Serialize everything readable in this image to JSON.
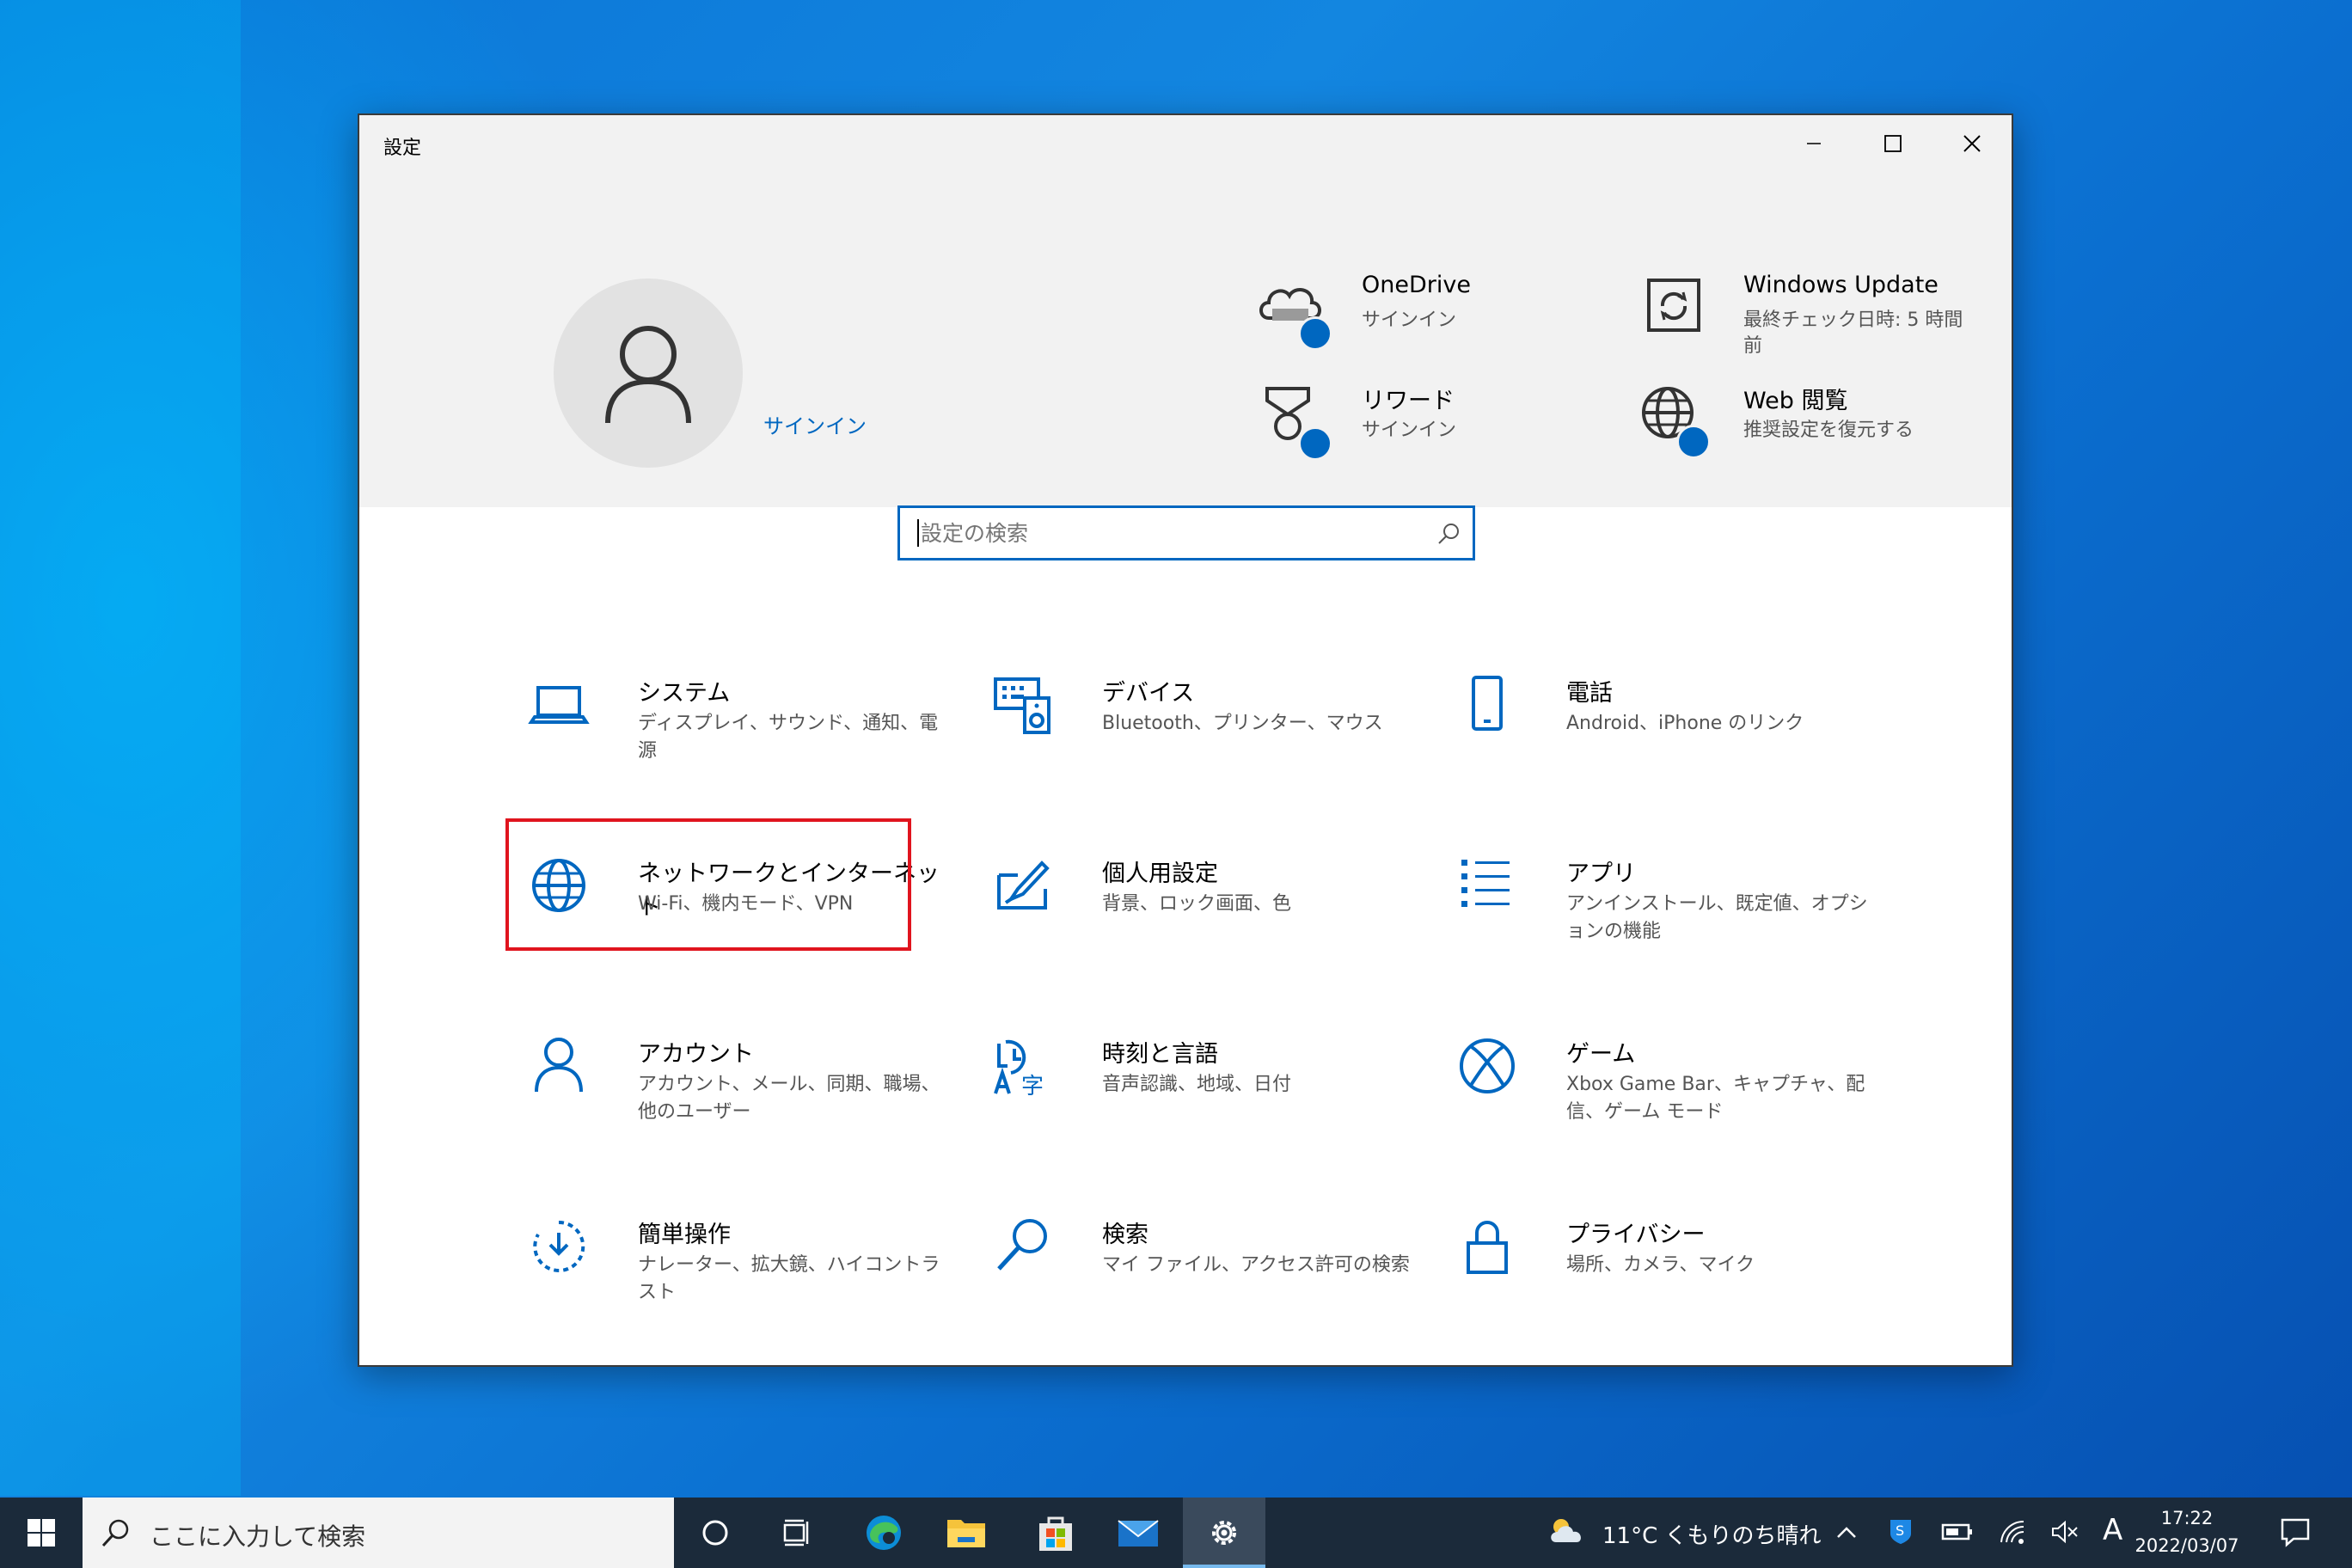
{
  "window": {
    "title": "設定",
    "minimize_glyph": "─",
    "maximize_glyph": "☐",
    "close_glyph": "✕"
  },
  "header": {
    "signin_label": "サインイン",
    "items": [
      {
        "title": "OneDrive",
        "subtitle": "サインイン",
        "icon": "cloud-icon"
      },
      {
        "title": "Windows Update",
        "subtitle": "最終チェック日時: 5 時間前",
        "icon": "update-icon"
      },
      {
        "title": "リワード",
        "subtitle": "サインイン",
        "icon": "rewards-icon"
      },
      {
        "title": "Web 閲覧",
        "subtitle": "推奨設定を復元する",
        "icon": "globe-icon"
      }
    ]
  },
  "search": {
    "placeholder": "設定の検索"
  },
  "categories": [
    {
      "title": "システム",
      "subtitle": "ディスプレイ、サウンド、通知、電源",
      "icon": "laptop-icon"
    },
    {
      "title": "デバイス",
      "subtitle": "Bluetooth、プリンター、マウス",
      "icon": "devices-icon"
    },
    {
      "title": "電話",
      "subtitle": "Android、iPhone のリンク",
      "icon": "phone-icon"
    },
    {
      "title": "ネットワークとインターネット",
      "subtitle": "Wi-Fi、機内モード、VPN",
      "icon": "globe-icon"
    },
    {
      "title": "個人用設定",
      "subtitle": "背景、ロック画面、色",
      "icon": "personalization-icon"
    },
    {
      "title": "アプリ",
      "subtitle": "アンインストール、既定値、オプションの機能",
      "icon": "apps-icon"
    },
    {
      "title": "アカウント",
      "subtitle": "アカウント、メール、同期、職場、他のユーザー",
      "icon": "person-icon"
    },
    {
      "title": "時刻と言語",
      "subtitle": "音声認識、地域、日付",
      "icon": "time-language-icon"
    },
    {
      "title": "ゲーム",
      "subtitle": "Xbox Game Bar、キャプチャ、配信、ゲーム モード",
      "icon": "xbox-icon"
    },
    {
      "title": "簡単操作",
      "subtitle": "ナレーター、拡大鏡、ハイコントラスト",
      "icon": "ease-of-access-icon"
    },
    {
      "title": "検索",
      "subtitle": "マイ ファイル、アクセス許可の検索",
      "icon": "search-icon"
    },
    {
      "title": "プライバシー",
      "subtitle": "場所、カメラ、マイク",
      "icon": "lock-icon"
    }
  ],
  "taskbar": {
    "search_placeholder": "ここに入力して検索",
    "weather": "11°C くもりのち晴れ",
    "ime": "A",
    "time": "17:22",
    "date": "2022/03/07"
  },
  "colors": {
    "accent": "#0067c0",
    "highlight": "#e0141e",
    "header_bg": "#f2f2f2"
  }
}
